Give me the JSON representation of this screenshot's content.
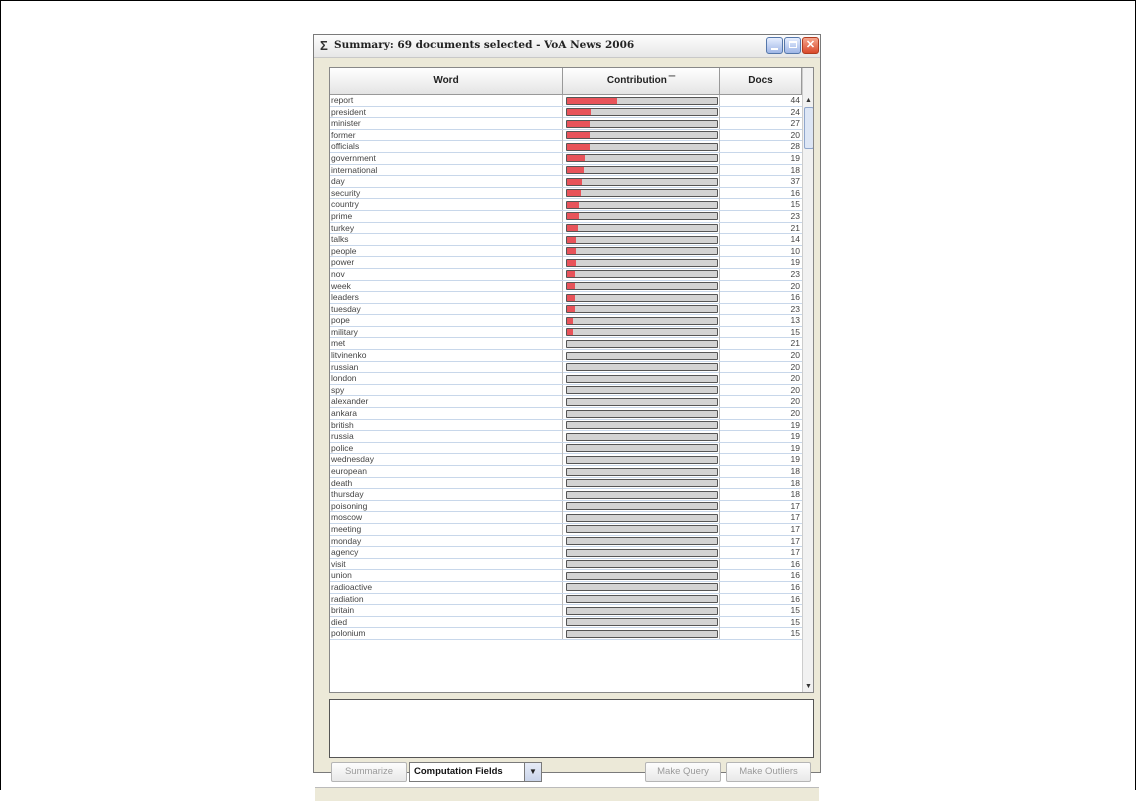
{
  "window": {
    "title": "Summary: 69 documents selected - VoA News 2006",
    "title_icon": "sigma-icon"
  },
  "table": {
    "columns": {
      "word": "Word",
      "contribution": "Contribution",
      "docs": "Docs"
    },
    "sort_column": "Contribution",
    "rows": [
      {
        "word": "report",
        "contribution": 0.33,
        "docs": "44"
      },
      {
        "word": "president",
        "contribution": 0.16,
        "docs": "24"
      },
      {
        "word": "minister",
        "contribution": 0.15,
        "docs": "27"
      },
      {
        "word": "former",
        "contribution": 0.15,
        "docs": "20"
      },
      {
        "word": "officials",
        "contribution": 0.15,
        "docs": "28"
      },
      {
        "word": "government",
        "contribution": 0.12,
        "docs": "19"
      },
      {
        "word": "international",
        "contribution": 0.11,
        "docs": "18"
      },
      {
        "word": "day",
        "contribution": 0.1,
        "docs": "37"
      },
      {
        "word": "security",
        "contribution": 0.09,
        "docs": "16"
      },
      {
        "word": "country",
        "contribution": 0.08,
        "docs": "15"
      },
      {
        "word": "prime",
        "contribution": 0.08,
        "docs": "23"
      },
      {
        "word": "turkey",
        "contribution": 0.07,
        "docs": "21"
      },
      {
        "word": "talks",
        "contribution": 0.06,
        "docs": "14"
      },
      {
        "word": "people",
        "contribution": 0.06,
        "docs": "10"
      },
      {
        "word": "power",
        "contribution": 0.06,
        "docs": "19"
      },
      {
        "word": "nov",
        "contribution": 0.05,
        "docs": "23"
      },
      {
        "word": "week",
        "contribution": 0.05,
        "docs": "20"
      },
      {
        "word": "leaders",
        "contribution": 0.05,
        "docs": "16"
      },
      {
        "word": "tuesday",
        "contribution": 0.05,
        "docs": "23"
      },
      {
        "word": "pope",
        "contribution": 0.04,
        "docs": "13"
      },
      {
        "word": "military",
        "contribution": 0.04,
        "docs": "15"
      },
      {
        "word": "met",
        "contribution": 0,
        "docs": "21"
      },
      {
        "word": "litvinenko",
        "contribution": 0,
        "docs": "20"
      },
      {
        "word": "russian",
        "contribution": 0,
        "docs": "20"
      },
      {
        "word": "london",
        "contribution": 0,
        "docs": "20"
      },
      {
        "word": "spy",
        "contribution": 0,
        "docs": "20"
      },
      {
        "word": "alexander",
        "contribution": 0,
        "docs": "20"
      },
      {
        "word": "ankara",
        "contribution": 0,
        "docs": "20"
      },
      {
        "word": "british",
        "contribution": 0,
        "docs": "19"
      },
      {
        "word": "russia",
        "contribution": 0,
        "docs": "19"
      },
      {
        "word": "police",
        "contribution": 0,
        "docs": "19"
      },
      {
        "word": "wednesday",
        "contribution": 0,
        "docs": "19"
      },
      {
        "word": "european",
        "contribution": 0,
        "docs": "18"
      },
      {
        "word": "death",
        "contribution": 0,
        "docs": "18"
      },
      {
        "word": "thursday",
        "contribution": 0,
        "docs": "18"
      },
      {
        "word": "poisoning",
        "contribution": 0,
        "docs": "17"
      },
      {
        "word": "moscow",
        "contribution": 0,
        "docs": "17"
      },
      {
        "word": "meeting",
        "contribution": 0,
        "docs": "17"
      },
      {
        "word": "monday",
        "contribution": 0,
        "docs": "17"
      },
      {
        "word": "agency",
        "contribution": 0,
        "docs": "17"
      },
      {
        "word": "visit",
        "contribution": 0,
        "docs": "16"
      },
      {
        "word": "union",
        "contribution": 0,
        "docs": "16"
      },
      {
        "word": "radioactive",
        "contribution": 0,
        "docs": "16"
      },
      {
        "word": "radiation",
        "contribution": 0,
        "docs": "16"
      },
      {
        "word": "britain",
        "contribution": 0,
        "docs": "15"
      },
      {
        "word": "died",
        "contribution": 0,
        "docs": "15"
      },
      {
        "word": "polonium",
        "contribution": 0,
        "docs": "15"
      }
    ]
  },
  "colors": {
    "bar_fill": "#e8535a",
    "bar_track": "#d3d3d3"
  },
  "footer": {
    "summarize_label": "Summarize",
    "combo_value": "Computation Fields",
    "make_query_label": "Make Query",
    "make_outliers_label": "Make Outliers"
  }
}
